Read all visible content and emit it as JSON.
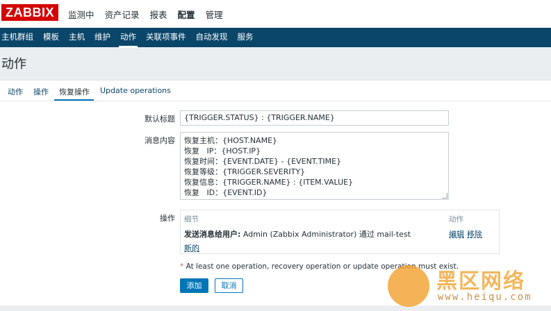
{
  "logo": "ZABBIX",
  "main_menu": [
    "监测中",
    "资产记录",
    "报表",
    "配置",
    "管理"
  ],
  "sub_menu": [
    "主机群组",
    "模板",
    "主机",
    "维护",
    "动作",
    "关联项事件",
    "自动发现",
    "服务"
  ],
  "page_title": "动作",
  "tabs": [
    "动作",
    "操作",
    "恢复操作",
    "Update operations"
  ],
  "form": {
    "default_subject_label": "默认标题",
    "default_subject_value": "{TRIGGER.STATUS} : {TRIGGER.NAME}",
    "message_label": "消息内容",
    "message_lines": [
      "恢复主机：{HOST.NAME}",
      "恢复   IP：{HOST.IP}",
      "恢复时间：{EVENT.DATE} - {EVENT.TIME}",
      "恢复等级：{TRIGGER.SEVERITY}",
      "恢复信息：{TRIGGER.NAME} : {ITEM.VALUE}",
      "恢复   ID：{EVENT.ID}"
    ],
    "operations_label": "操作",
    "operations": {
      "col_details": "细节",
      "col_action": "动作",
      "row_bold": "发送消息给用户:",
      "row_text": " Admin (Zabbix Administrator) 通过 mail-test",
      "edit_link": "编辑",
      "remove_link": "移除",
      "new_link": "新的"
    },
    "warning_star": "*",
    "warning_text": "At least one operation, recovery operation or update operation must exist.",
    "add_button": "添加",
    "cancel_button": "取消"
  },
  "watermark": {
    "text": "黑区网络",
    "url": "www.heiqu.com"
  },
  "colors": {
    "brand_red": "#d40000",
    "nav_blue": "#0a466a",
    "primary_blue": "#0275b8",
    "watermark_orange": "#f0a028"
  }
}
